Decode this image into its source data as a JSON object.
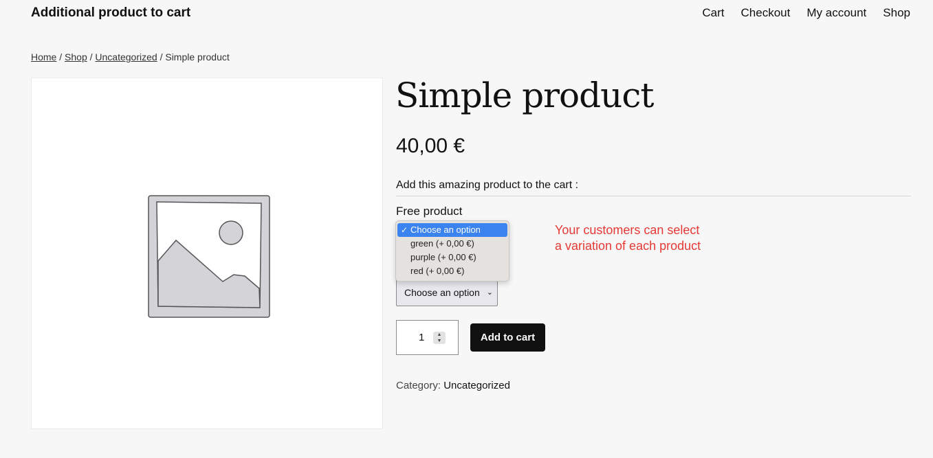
{
  "header": {
    "site_title": "Additional product to cart",
    "nav": [
      "Cart",
      "Checkout",
      "My account",
      "Shop"
    ]
  },
  "breadcrumb": {
    "home": "Home",
    "shop": "Shop",
    "category": "Uncategorized",
    "sep": "/",
    "current": "Simple product"
  },
  "product": {
    "title": "Simple product",
    "price": "40,00 €",
    "addon_heading": "Add this amazing product to the cart :",
    "free_label": "Free product",
    "select_value": "Choose an option",
    "dropdown": {
      "check": "✓",
      "options": [
        "Choose an option",
        "green (+ 0,00 €)",
        "purple (+ 0,00 €)",
        "red (+ 0,00 €)"
      ]
    },
    "annotation_lines": [
      "Your customers can select",
      "a variation of each product"
    ],
    "quantity": "1",
    "add_to_cart": "Add to cart",
    "category_label": "Category:",
    "category_value": "Uncategorized"
  },
  "colors": {
    "accent_selection": "#3b84f0",
    "annotation": "#e53935",
    "button": "#111111"
  },
  "icons": [
    "placeholder-image-icon",
    "checkmark-icon",
    "chevron-down-icon",
    "spinner-arrows-icon"
  ]
}
